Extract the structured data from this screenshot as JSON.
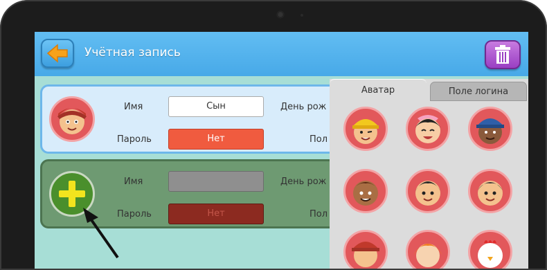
{
  "header": {
    "title": "Учётная запись"
  },
  "accounts": [
    {
      "name_label": "Имя",
      "name_value": "Сын",
      "password_label": "Пароль",
      "password_value": "Нет",
      "birthday_label": "День рож",
      "gender_label": "Пол"
    },
    {
      "name_label": "Имя",
      "name_value": "",
      "password_label": "Пароль",
      "password_value": "Нет",
      "birthday_label": "День рож",
      "gender_label": "Пол"
    }
  ],
  "panel": {
    "tabs": [
      {
        "label": "Аватар"
      },
      {
        "label": "Поле логина"
      }
    ],
    "avatars": [
      "avatar-boy-yellow-cap",
      "avatar-girl-pink",
      "avatar-boy-blue-cap",
      "avatar-boy-brown",
      "avatar-girl-black-hair",
      "avatar-boy-gray",
      "avatar-boy-red-cap",
      "avatar-girl-orange-hair",
      "avatar-chicken"
    ]
  },
  "colors": {
    "accent": "#47a9e8",
    "password_active": "#f05b3f",
    "password_disabled": "#8c2a20",
    "trash": "#9a3fc3"
  },
  "icons": {
    "back": "arrow-left-icon",
    "trash": "trash-icon",
    "add": "plus-icon"
  }
}
